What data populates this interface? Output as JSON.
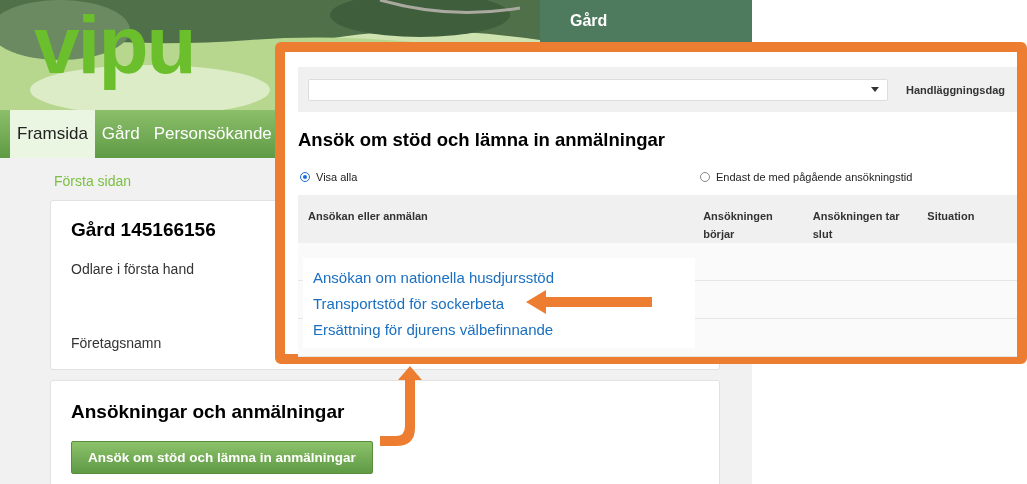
{
  "header": {
    "logo": "vipu",
    "farm_label": "Gård"
  },
  "nav": {
    "tabs": [
      {
        "label": "Framsida",
        "selected": true
      },
      {
        "label": "Gård",
        "selected": false
      },
      {
        "label": "Personsökande",
        "selected": false
      }
    ]
  },
  "breadcrumb": "Första sidan",
  "farm_card": {
    "title": "Gård 145166156",
    "role": "Odlare i första hand",
    "company_label": "Företagsnamn"
  },
  "applications_card": {
    "title": "Ansökningar och anmälningar",
    "button": "Ansök om stöd och lämna in anmälningar"
  },
  "zoom_panel": {
    "toolbar": {
      "date_label": "Handläggningsdag"
    },
    "title": "Ansök om stöd och lämna in anmälningar",
    "filters": [
      {
        "label": "Visa alla",
        "selected": true
      },
      {
        "label": "Endast de med pågående ansökningstid",
        "selected": false
      }
    ],
    "table": {
      "columns": [
        "Ansökan eller anmälan",
        "Ansökningen börjar",
        "Ansökningen tar slut",
        "Situation"
      ]
    },
    "dropdown_links": [
      "Ansökan om nationella husdjursstöd",
      "Transportstöd för sockerbeta",
      "Ersättning för djurens välbefinnande"
    ]
  }
}
